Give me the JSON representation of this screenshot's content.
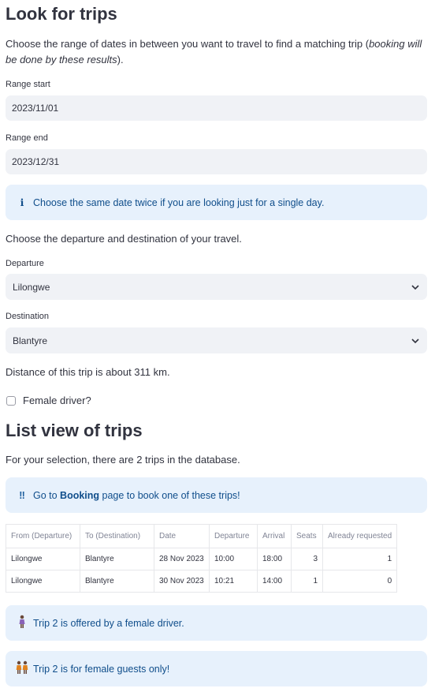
{
  "section1": {
    "title": "Look for trips",
    "intro_plain": "Choose the range of dates in between you want to travel to find a matching trip (",
    "intro_italic": "booking will be done by these results",
    "intro_end": ")."
  },
  "range_start": {
    "label": "Range start",
    "value": "2023/11/01"
  },
  "range_end": {
    "label": "Range end",
    "value": "2023/12/31"
  },
  "info_same_date": {
    "icon": "info-icon",
    "text": "Choose the same date twice if you are looking just for a single day."
  },
  "choose_text": "Choose the departure and destination of your travel.",
  "departure": {
    "label": "Departure",
    "value": "Lilongwe"
  },
  "destination": {
    "label": "Destination",
    "value": "Blantyre"
  },
  "distance_text": "Distance of this trip is about 311 km.",
  "female_driver": {
    "label": "Female driver?",
    "checked": false
  },
  "section2": {
    "title": "List view of trips"
  },
  "selection_text": "For your selection, there are 2 trips in the database.",
  "info_booking": {
    "icon": "double-exclamation-icon",
    "prefix": "Go to ",
    "bold": "Booking",
    "suffix": " page to book one of these trips!"
  },
  "table": {
    "columns": [
      "From (Departure)",
      "To (Destination)",
      "Date",
      "Departure",
      "Arrival",
      "Seats",
      "Already requested"
    ],
    "rows": [
      [
        "Lilongwe",
        "Blantyre",
        "28 Nov 2023",
        "10:00",
        "18:00",
        "3",
        "1"
      ],
      [
        "Lilongwe",
        "Blantyre",
        "30 Nov 2023",
        "10:21",
        "14:00",
        "1",
        "0"
      ]
    ]
  },
  "info_female_driver": {
    "icon": "woman-standing-icon",
    "text": "Trip 2 is offered by a female driver."
  },
  "info_female_guests": {
    "icon": "two-women-icon",
    "text": "Trip 2 is for female guests only!"
  }
}
